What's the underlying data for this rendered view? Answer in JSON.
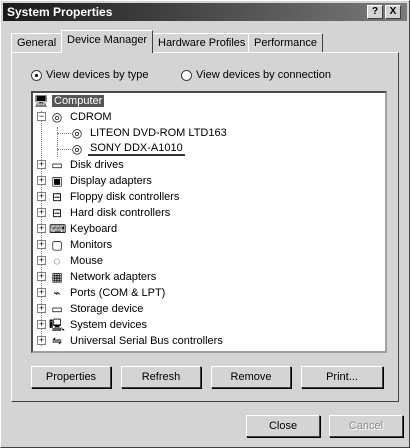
{
  "window": {
    "title": "System Properties"
  },
  "titlebar_buttons": {
    "help": "?",
    "close": "X"
  },
  "tabs": [
    {
      "label": "General"
    },
    {
      "label": "Device Manager"
    },
    {
      "label": "Hardware Profiles"
    },
    {
      "label": "Performance"
    }
  ],
  "view_options": {
    "by_type": "View devices by type",
    "by_connection": "View devices by connection",
    "selected": "by_type"
  },
  "tree": {
    "root": "Computer",
    "cdrom": {
      "label": "CDROM",
      "children": [
        "LITEON DVD-ROM LTD163",
        "SONY DDX-A1010"
      ]
    },
    "categories": [
      "Disk drives",
      "Display adapters",
      "Floppy disk controllers",
      "Hard disk controllers",
      "Keyboard",
      "Monitors",
      "Mouse",
      "Network adapters",
      "Ports (COM & LPT)",
      "Storage device",
      "System devices",
      "Universal Serial Bus controllers"
    ]
  },
  "actions": {
    "properties": "Properties",
    "refresh": "Refresh",
    "remove": "Remove",
    "print": "Print..."
  },
  "dialog": {
    "close": "Close",
    "cancel": "Cancel"
  }
}
